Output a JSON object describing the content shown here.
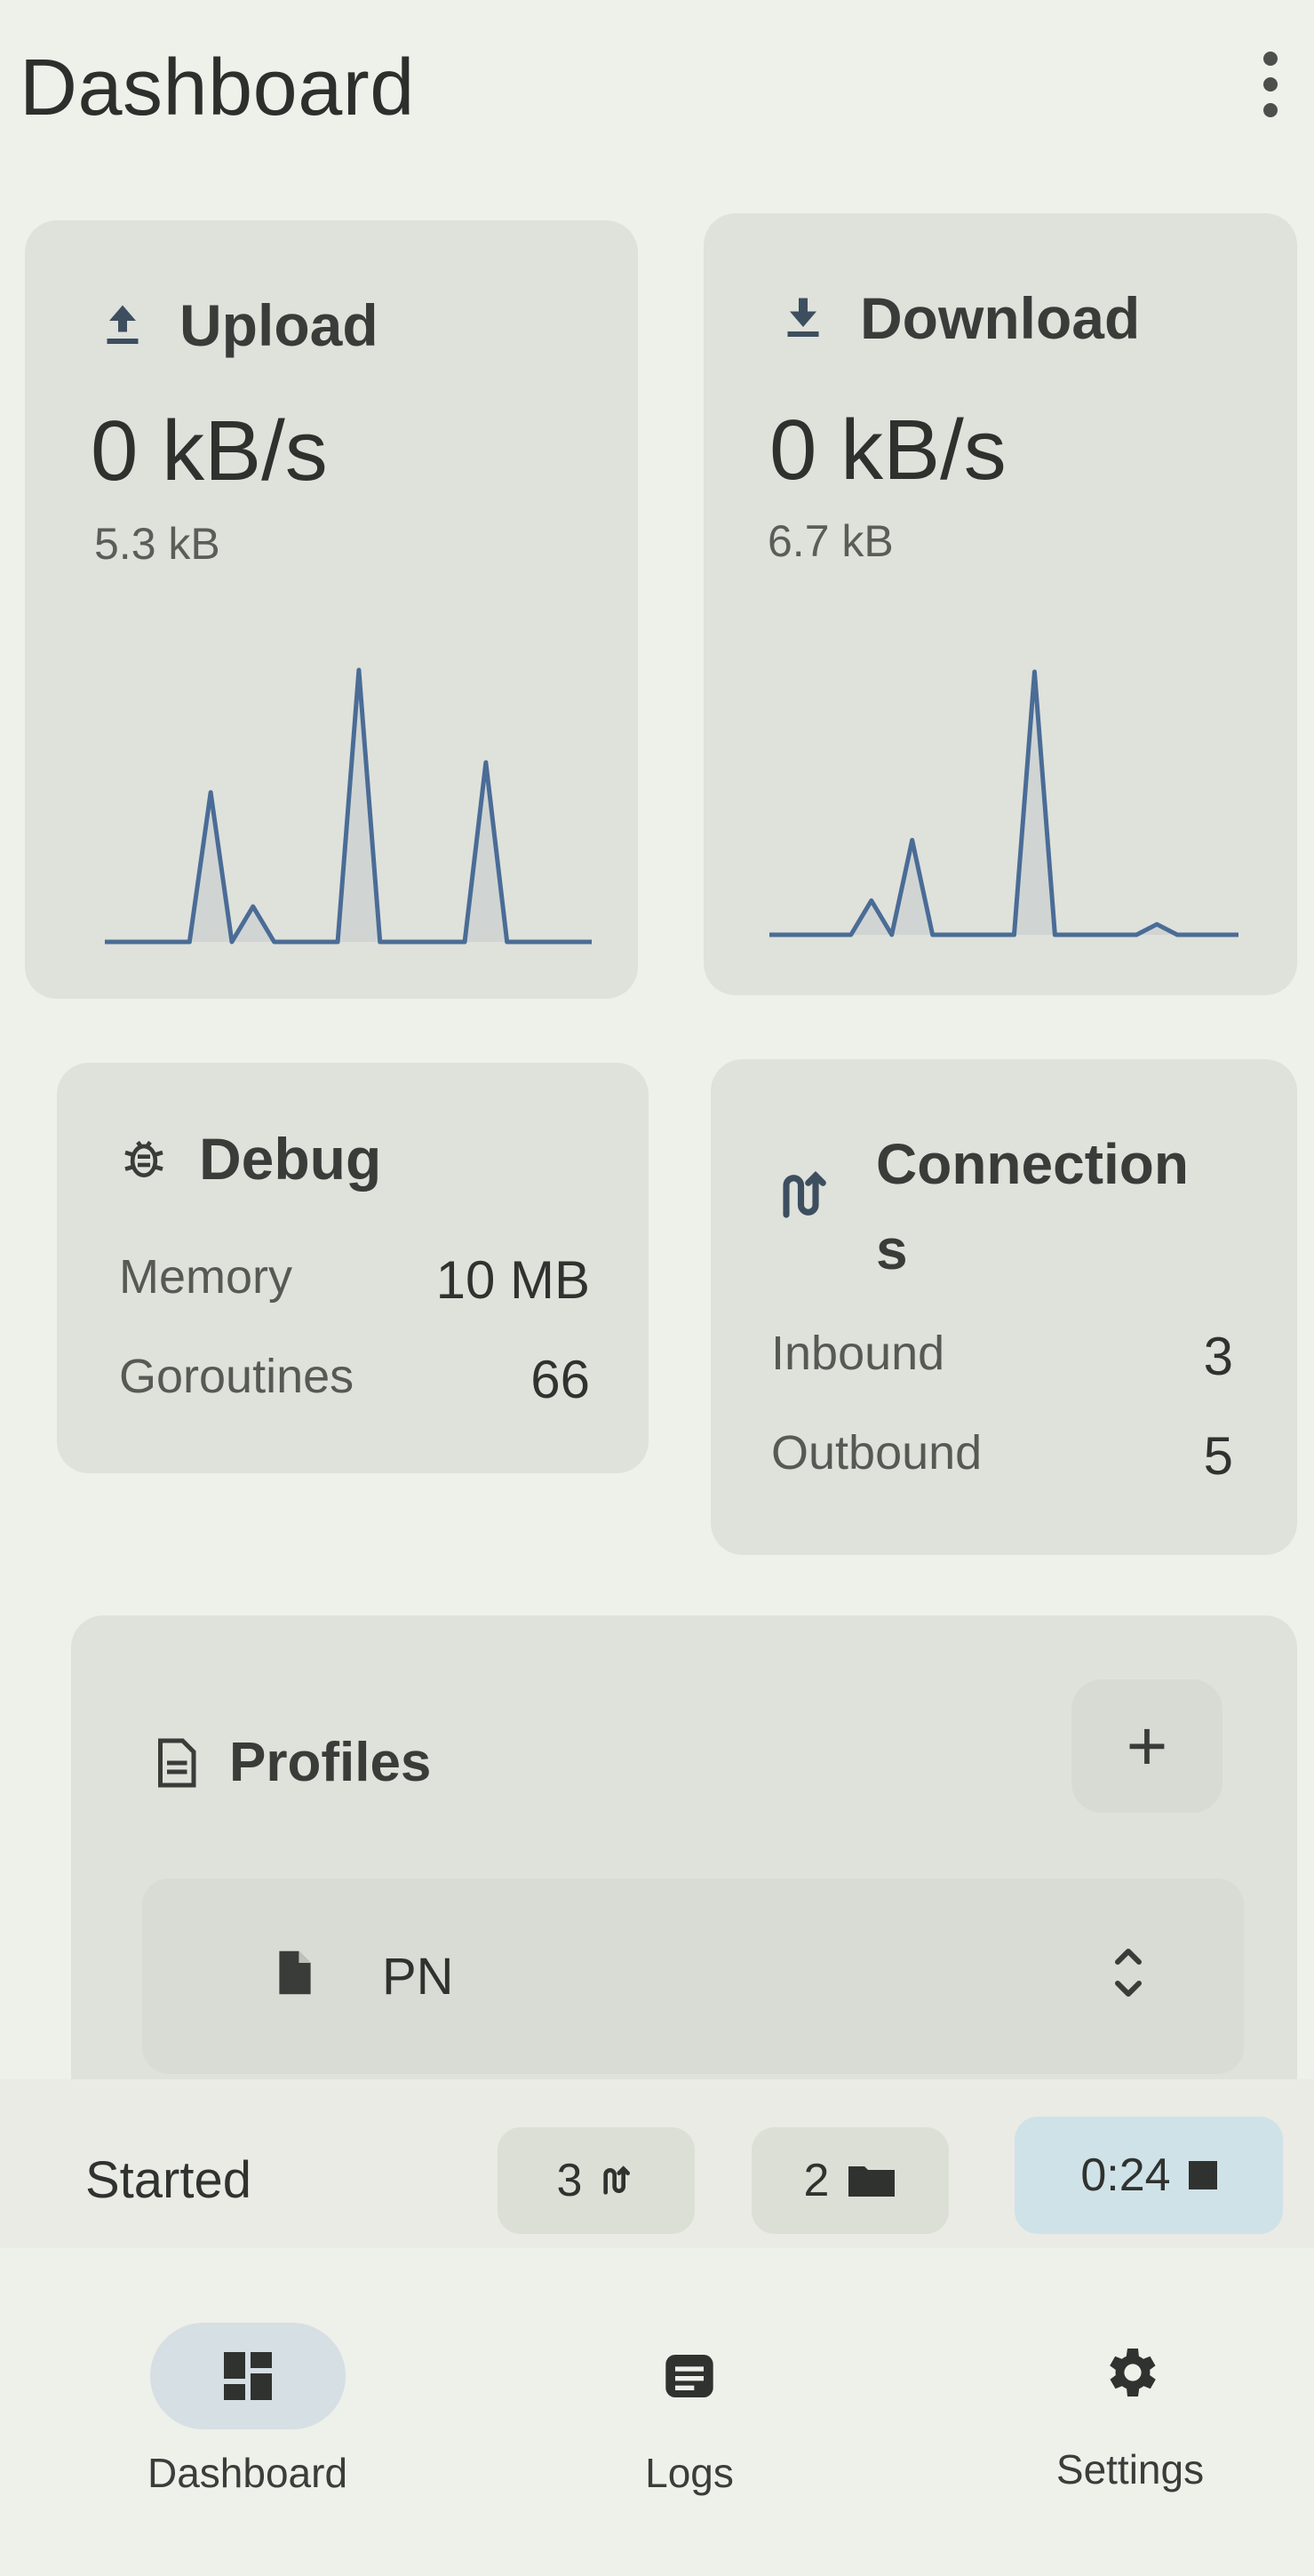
{
  "header": {
    "title": "Dashboard",
    "menu_icon": "more-vert-icon"
  },
  "upload": {
    "label": "Upload",
    "rate": "0 kB/s",
    "total": "5.3 kB",
    "icon": "upload-icon"
  },
  "download": {
    "label": "Download",
    "rate": "0 kB/s",
    "total": "6.7 kB",
    "icon": "download-icon"
  },
  "debug": {
    "label": "Debug",
    "icon": "bug-icon",
    "rows": [
      {
        "key": "Memory",
        "value": "10 MB"
      },
      {
        "key": "Goroutines",
        "value": "66"
      }
    ]
  },
  "connections": {
    "label_line1": "Connection",
    "label_line2": "s",
    "icon": "connections-icon",
    "rows": [
      {
        "key": "Inbound",
        "value": "3"
      },
      {
        "key": "Outbound",
        "value": "5"
      }
    ]
  },
  "profiles": {
    "label": "Profiles",
    "add_label": "+",
    "selected": "PN",
    "icon": "document-icon"
  },
  "status": {
    "text": "Started",
    "connections_count": "3",
    "groups_count": "2",
    "uptime": "0:24"
  },
  "nav": {
    "items": [
      {
        "label": "Dashboard",
        "icon": "dashboard-icon",
        "active": true
      },
      {
        "label": "Logs",
        "icon": "logs-icon",
        "active": false
      },
      {
        "label": "Settings",
        "icon": "gear-icon",
        "active": false
      }
    ]
  },
  "colors": {
    "card": "#dfe1db",
    "line": "#4a6c96",
    "accent_chip": "#cfe2e8",
    "nav_active": "#d5dfe4"
  },
  "chart_data": [
    {
      "type": "line",
      "name": "upload-sparkline",
      "values": [
        0,
        0,
        0,
        0,
        0,
        0.55,
        0,
        0.13,
        0,
        0,
        0,
        0,
        1.0,
        0,
        0,
        0,
        0,
        0,
        0.66,
        0,
        0,
        0,
        0,
        0
      ]
    },
    {
      "type": "line",
      "name": "download-sparkline",
      "values": [
        0,
        0,
        0,
        0,
        0,
        0.13,
        0,
        0.36,
        0,
        0,
        0,
        0,
        0,
        1.0,
        0,
        0,
        0,
        0,
        0,
        0.04,
        0,
        0,
        0,
        0
      ]
    }
  ]
}
